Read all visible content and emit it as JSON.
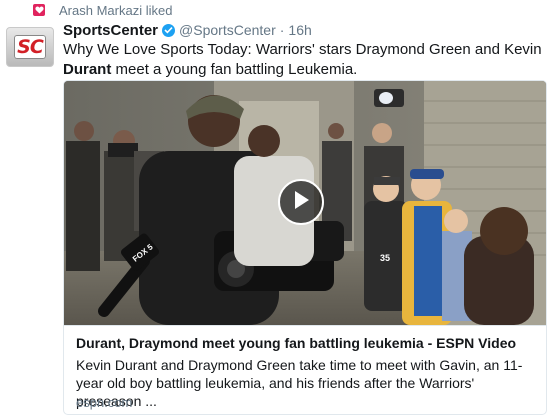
{
  "social_context": {
    "icon": "heart-icon",
    "text": "Arash Markazi liked"
  },
  "tweet": {
    "avatar_logo": "SC",
    "display_name": "SportsCenter",
    "verified_icon": "verified-badge-icon",
    "handle": "@SportsCenter",
    "separator": "·",
    "timestamp": "16h",
    "text_before": "Why We Love Sports Today: Warriors' stars Draymond Green and Kevin ",
    "text_bold": "Durant",
    "text_after": " meet a young fan battling Leukemia."
  },
  "card": {
    "media_alt": "Video thumbnail: Kevin Durant meets young fans in arena hallway",
    "microphone_label": "FOX 5",
    "jersey_number": "35",
    "play_icon": "play-icon",
    "title": "Durant, Draymond meet young fan battling leukemia - ESPN Video",
    "description": "Kevin Durant and Draymond Green take time to meet with Gavin, an 11-year old boy battling leukemia, and his friends after the Warriors' preseason ...",
    "domain": "espn.com"
  },
  "colors": {
    "heart": "#e0245e",
    "verified": "#1da1f2",
    "secondary_text": "#657786",
    "card_border": "#e1e8ed"
  }
}
